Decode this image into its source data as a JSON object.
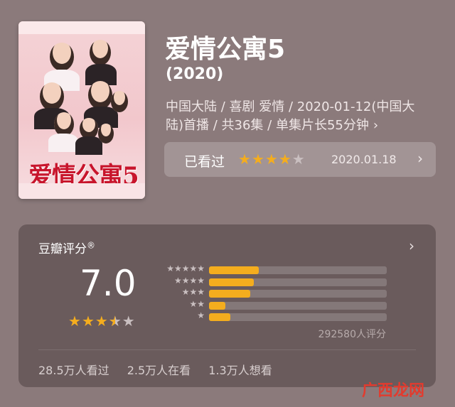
{
  "movie": {
    "title": "爱情公寓5",
    "year": "(2020)",
    "meta": "中国大陆 / 喜剧 爱情 / 2020-01-12(中国大陆)首播 / 共36集 / 单集片长55分钟",
    "poster_title": "爱情公寓5"
  },
  "watched": {
    "label": "已看过",
    "user_stars": 4,
    "date": "2020.01.18"
  },
  "rating": {
    "header": "豆瓣评分",
    "score": "7.0",
    "score_stars": 3.5,
    "distribution": [
      {
        "stars": 5,
        "fraction": 0.28
      },
      {
        "stars": 4,
        "fraction": 0.25
      },
      {
        "stars": 3,
        "fraction": 0.23
      },
      {
        "stars": 2,
        "fraction": 0.09
      },
      {
        "stars": 1,
        "fraction": 0.12
      }
    ],
    "votes": "292580人评分",
    "stats": [
      "28.5万人看过",
      "2.5万人在看",
      "1.3万人想看"
    ]
  },
  "icons": {
    "chevron": "chevron-right-icon",
    "star": "star-icon"
  },
  "colors": {
    "accent": "#f4ad1e",
    "background": "#8b7a7b"
  },
  "watermark": "广西龙网"
}
